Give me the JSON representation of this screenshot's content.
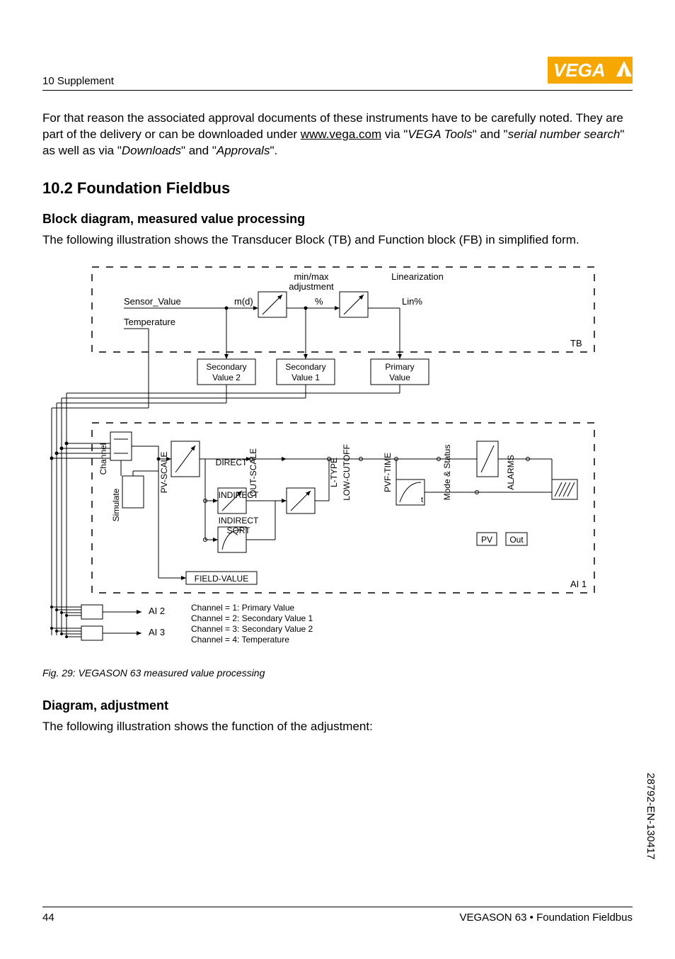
{
  "header": {
    "section_label": "10 Supplement"
  },
  "intro_paragraph": {
    "line1_before": "For that reason the associated approval documents of these instruments have to be carefully noted. They are part of the delivery or can be downloaded under ",
    "url": "www.vega.com",
    "via": " via \"",
    "vega_tools": "VEGA Tools",
    "mid1": "\" and \"",
    "serial": "serial number search",
    "mid2": "\" as well as via \"",
    "downloads": "Downloads",
    "mid3": "\" and \"",
    "approvals": "Approvals",
    "end": "\"."
  },
  "h2": "10.2   Foundation Fieldbus",
  "h3a": "Block diagram, measured value processing",
  "para2a": "The following illustration shows the Transducer Block (TB) and Function block (FB) in simplified form.",
  "caption": "Fig. 29: VEGASON 63 measured value processing",
  "h3b": "Diagram, adjustment",
  "para2b": "The following illustration shows the function of the adjustment:",
  "footer": {
    "page": "44",
    "product": "VEGASON 63 • Foundation Fieldbus"
  },
  "side_code": "28792-EN-130417",
  "diagram": {
    "minmax": "min/max\nadjustment",
    "linearization": "Linearization",
    "sensor_value": "Sensor_Value",
    "temperature": "Temperature",
    "md": "m(d)",
    "pct": "%",
    "linpct": "Lin%",
    "tb": "TB",
    "sec2": "Secondary\nValue 2",
    "sec1": "Secondary\nValue 1",
    "primary": "Primary\nValue",
    "channel": "Channel",
    "simulate": "Simulate",
    "pvscale": "PV-SCALE",
    "outscale": "OUT-SCALE",
    "direct": "DIRECT",
    "indirect": "INDIRECT",
    "indirect_sqrt": "INDIRECT\nSQRT",
    "ltype": "L-TYPE",
    "lowcutoff": "LOW-CUTOFF",
    "pvftime": "PVF-TIME",
    "mode_status": "Mode & Status",
    "alarms": "ALARMS",
    "t": "t",
    "pv": "PV",
    "out": "Out",
    "field_value": "FIELD-VALUE",
    "ai1": "AI 1",
    "ai2": "AI 2",
    "ai3": "AI 3",
    "channels_line1": "Channel = 1: Primary Value",
    "channels_line2": "Channel = 2: Secondary Value 1",
    "channels_line3": "Channel = 3: Secondary Value 2",
    "channels_line4": "Channel = 4: Temperature"
  }
}
